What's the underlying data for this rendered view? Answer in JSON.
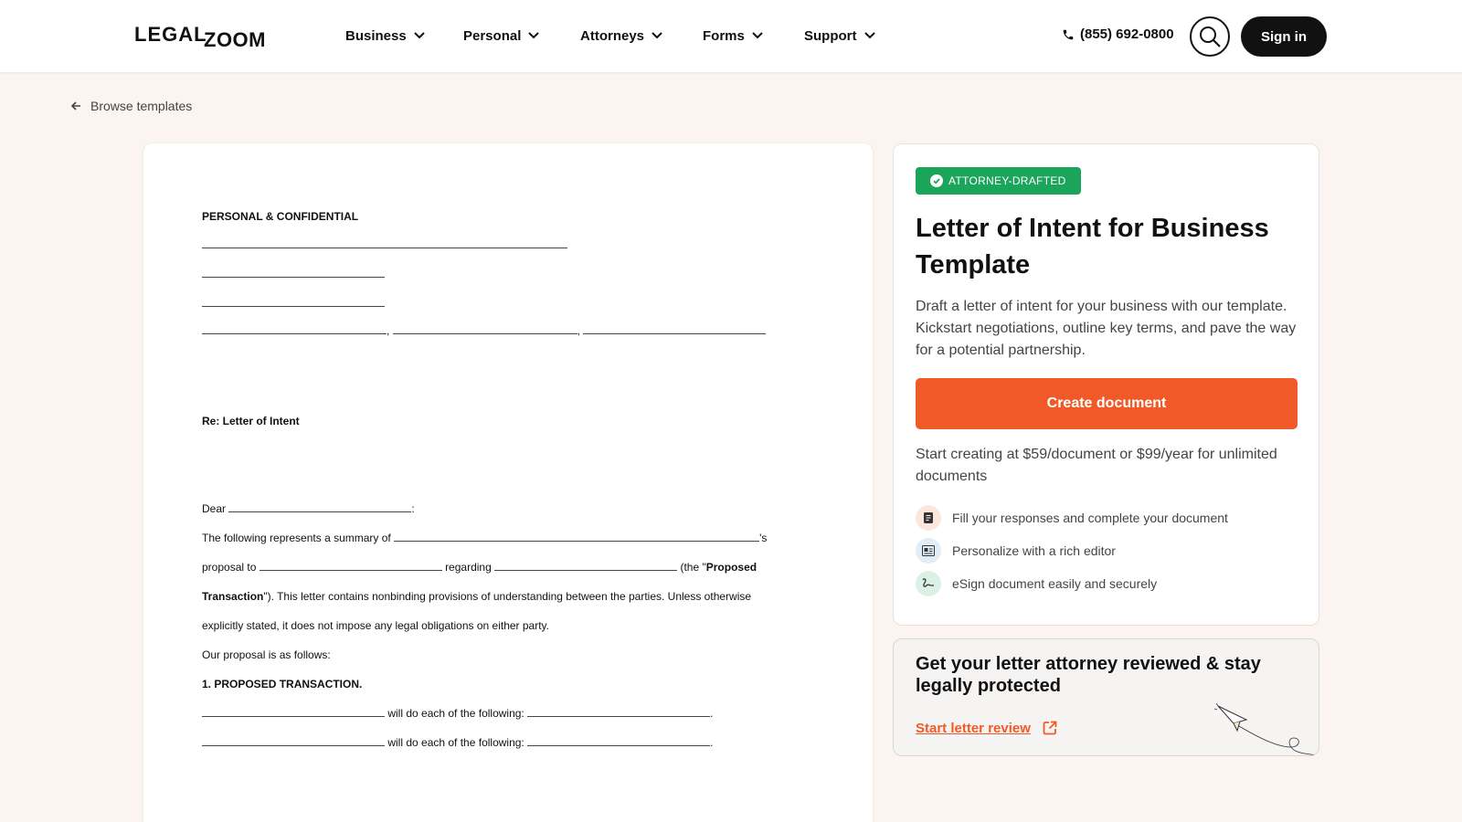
{
  "header": {
    "logo_part1": "LEGAL",
    "logo_part2": "ZOOM",
    "nav": [
      "Business",
      "Personal",
      "Attorneys",
      "Forms",
      "Support"
    ],
    "phone": "(855) 692-0800",
    "signin_label": "Sign in"
  },
  "breadcrumb": {
    "back_label": "Browse templates"
  },
  "document": {
    "heading": "PERSONAL & CONFIDENTIAL",
    "re_line": "Re: Letter of Intent",
    "dear": "Dear",
    "colon": ":",
    "summary_a": "The following represents a summary of",
    "summary_b": "'s",
    "proposal_a": "proposal to",
    "proposal_b": "regarding",
    "proposal_c": "(the \"",
    "proposal_bold": "Proposed",
    "transaction_bold": "Transaction",
    "transaction_rest": "\"). This letter contains nonbinding provisions of understanding between the parties. Unless otherwise",
    "explicit": "explicitly stated, it does not impose any legal obligations on either party.",
    "our_proposal": "Our proposal is as follows:",
    "section1": "1. PROPOSED TRANSACTION.",
    "will_do": "will do each of the following:",
    "period": "."
  },
  "panel": {
    "badge": "ATTORNEY-DRAFTED",
    "title": "Letter of Intent for Business Template",
    "description": "Draft a letter of intent for your business with our template. Kickstart negotiations, outline key terms, and pave the way for a potential partnership.",
    "cta": "Create document",
    "pricing": "Start creating at $59/document or $99/year for unlimited documents",
    "features": [
      "Fill your responses and complete your document",
      "Personalize with a rich editor",
      "eSign document easily and securely"
    ]
  },
  "review": {
    "title": "Get your letter attorney reviewed & stay legally protected",
    "link": "Start letter review"
  },
  "colors": {
    "accent": "#f05a28",
    "badge_green": "#1aa55b",
    "page_bg": "#fcf4f0"
  }
}
